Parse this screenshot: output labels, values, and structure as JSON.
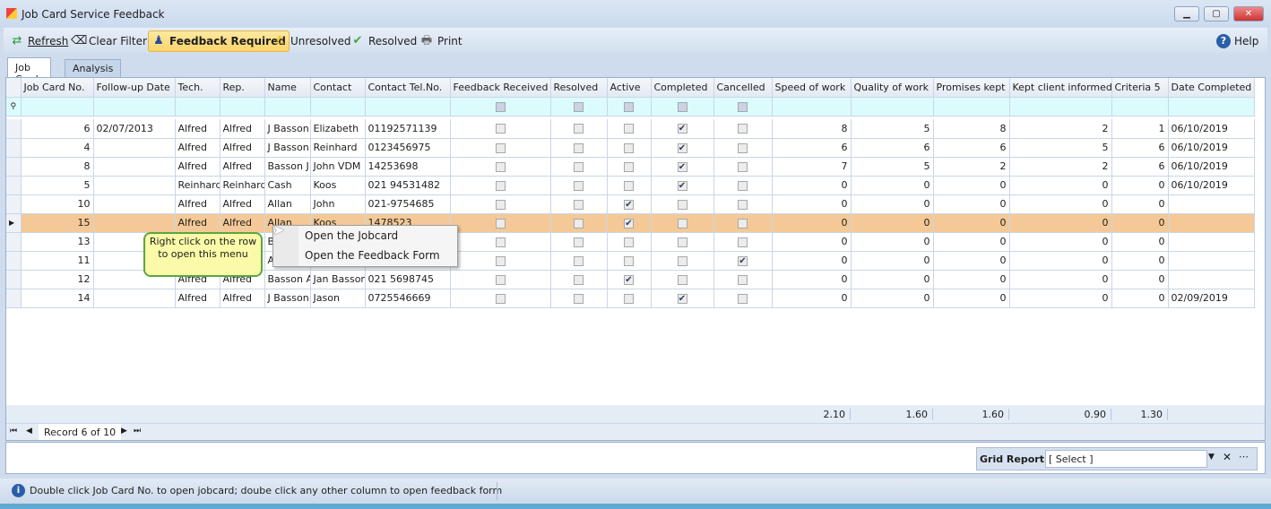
{
  "window": {
    "title": "Job Card Service Feedback",
    "minimize": "▁",
    "maximize": "▢",
    "close": "✕"
  },
  "toolbar": {
    "refresh": "Refresh",
    "clear_filter": "Clear Filter",
    "feedback_required": "Feedback Required",
    "unresolved": "Unresolved",
    "resolved": "Resolved",
    "print": "Print",
    "help": "Help"
  },
  "tabs": [
    {
      "label": "Job Cards",
      "active": true
    },
    {
      "label": "Analysis",
      "active": false
    }
  ],
  "grid": {
    "columns": [
      "Job Card No.",
      "Follow-up Date",
      "Tech.",
      "Rep.",
      "Name",
      "Contact",
      "Contact Tel.No.",
      "Feedback Received",
      "Resolved",
      "Active",
      "Completed",
      "Cancelled",
      "Speed of work",
      "Quality of work",
      "Promises kept",
      "Kept client informed",
      "Criteria 5",
      "Date Completed"
    ],
    "rows": [
      {
        "no": "6",
        "followup": "02/07/2013",
        "tech": "Alfred",
        "rep": "Alfred",
        "name": "J Basson",
        "contact": "Elizabeth",
        "tel": "01192571139",
        "fb": false,
        "res": false,
        "act": false,
        "comp": true,
        "canc": false,
        "speed": "8",
        "quality": "5",
        "promises": "8",
        "informed": "2",
        "c5": "1",
        "date": "06/10/2019"
      },
      {
        "no": "4",
        "followup": "",
        "tech": "Alfred",
        "rep": "Alfred",
        "name": "J Basson",
        "contact": "Reinhard",
        "tel": "0123456975",
        "fb": false,
        "res": false,
        "act": false,
        "comp": true,
        "canc": false,
        "speed": "6",
        "quality": "6",
        "promises": "6",
        "informed": "5",
        "c5": "6",
        "date": "06/10/2019"
      },
      {
        "no": "8",
        "followup": "",
        "tech": "Alfred",
        "rep": "Alfred",
        "name": "Basson J",
        "contact": "John VDM",
        "tel": "14253698",
        "fb": false,
        "res": false,
        "act": false,
        "comp": true,
        "canc": false,
        "speed": "7",
        "quality": "5",
        "promises": "2",
        "informed": "2",
        "c5": "6",
        "date": "06/10/2019"
      },
      {
        "no": "5",
        "followup": "",
        "tech": "Reinhard",
        "rep": "Reinhard",
        "name": "Cash",
        "contact": "Koos",
        "tel": "021 94531482",
        "fb": false,
        "res": false,
        "act": false,
        "comp": true,
        "canc": false,
        "speed": "0",
        "quality": "0",
        "promises": "0",
        "informed": "0",
        "c5": "0",
        "date": "06/10/2019"
      },
      {
        "no": "10",
        "followup": "",
        "tech": "Alfred",
        "rep": "Alfred",
        "name": "Allan",
        "contact": "John",
        "tel": "021-9754685",
        "fb": false,
        "res": false,
        "act": true,
        "comp": false,
        "canc": false,
        "speed": "0",
        "quality": "0",
        "promises": "0",
        "informed": "0",
        "c5": "0",
        "date": ""
      },
      {
        "no": "15",
        "followup": "",
        "tech": "Alfred",
        "rep": "Alfred",
        "name": "Allan",
        "contact": "Koos",
        "tel": "1478523",
        "fb": false,
        "res": false,
        "act": true,
        "comp": false,
        "canc": false,
        "speed": "0",
        "quality": "0",
        "promises": "0",
        "informed": "0",
        "c5": "0",
        "date": "",
        "selected": true
      },
      {
        "no": "13",
        "followup": "",
        "tech": "",
        "rep": "",
        "name": "B",
        "contact": "",
        "tel": "",
        "fb": false,
        "res": false,
        "act": false,
        "comp": false,
        "canc": false,
        "speed": "0",
        "quality": "0",
        "promises": "0",
        "informed": "0",
        "c5": "0",
        "date": ""
      },
      {
        "no": "11",
        "followup": "",
        "tech": "",
        "rep": "",
        "name": "A",
        "contact": "",
        "tel": "",
        "fb": false,
        "res": false,
        "act": false,
        "comp": false,
        "canc": true,
        "speed": "0",
        "quality": "0",
        "promises": "0",
        "informed": "0",
        "c5": "0",
        "date": ""
      },
      {
        "no": "12",
        "followup": "",
        "tech": "Alfred",
        "rep": "Alfred",
        "name": "Basson A",
        "contact": "Jan Basson",
        "tel": "021 5698745",
        "fb": false,
        "res": false,
        "act": true,
        "comp": false,
        "canc": false,
        "speed": "0",
        "quality": "0",
        "promises": "0",
        "informed": "0",
        "c5": "0",
        "date": ""
      },
      {
        "no": "14",
        "followup": "",
        "tech": "Alfred",
        "rep": "Alfred",
        "name": "J Basson",
        "contact": "Jason",
        "tel": "0725546669",
        "fb": false,
        "res": false,
        "act": false,
        "comp": true,
        "canc": false,
        "speed": "0",
        "quality": "0",
        "promises": "0",
        "informed": "0",
        "c5": "0",
        "date": "02/09/2019"
      }
    ],
    "summary": {
      "speed": "2.10",
      "quality": "1.60",
      "promises": "1.60",
      "informed": "0.90",
      "c5": "1.30"
    },
    "record_nav": "Record 6 of 10"
  },
  "context_menu": {
    "items": [
      "Open the Jobcard",
      "Open the Feedback Form"
    ]
  },
  "tooltip": "Right click on the row to open this menu",
  "grid_report": {
    "label": "Grid Report:",
    "value": "[ Select ]"
  },
  "status": "Double click Job Card No. to open jobcard; doube click any other column to open feedback form",
  "colors": {
    "selected_row": "#f4c997",
    "filter_row": "#dcfbfd",
    "active_button": "#f9d56c",
    "tooltip_bg": "#fafaa8",
    "tooltip_border": "#5aa642"
  }
}
